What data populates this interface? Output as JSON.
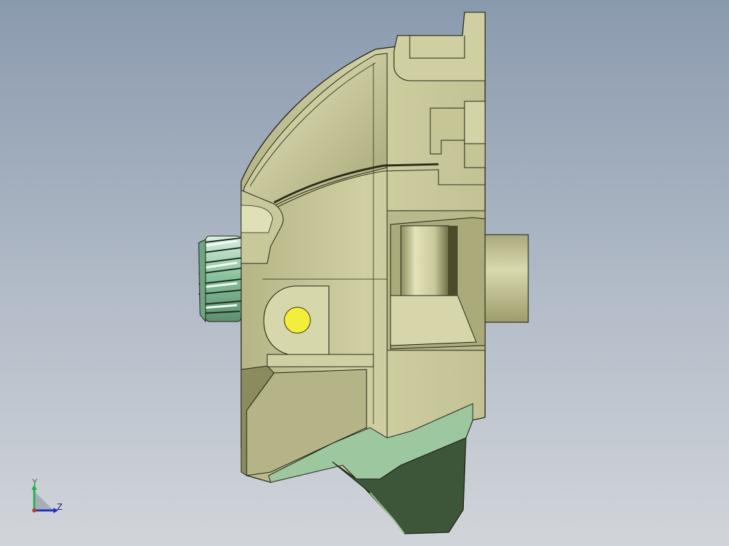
{
  "viewport": {
    "background_top": "#8a9aae",
    "background_bottom": "#d1d5da"
  },
  "model": {
    "part_color": "#c8c89a",
    "part_dark": "#8d8d5c",
    "gear_color": "#9fd0b0",
    "base_green": "#9cc79f",
    "base_dark": "#3d5538",
    "hole_color": "#f2ee3a"
  },
  "triad": {
    "y_label": "Y",
    "z_label": "Z",
    "y_color": "#22b14c",
    "z_color": "#1f2fbf"
  }
}
